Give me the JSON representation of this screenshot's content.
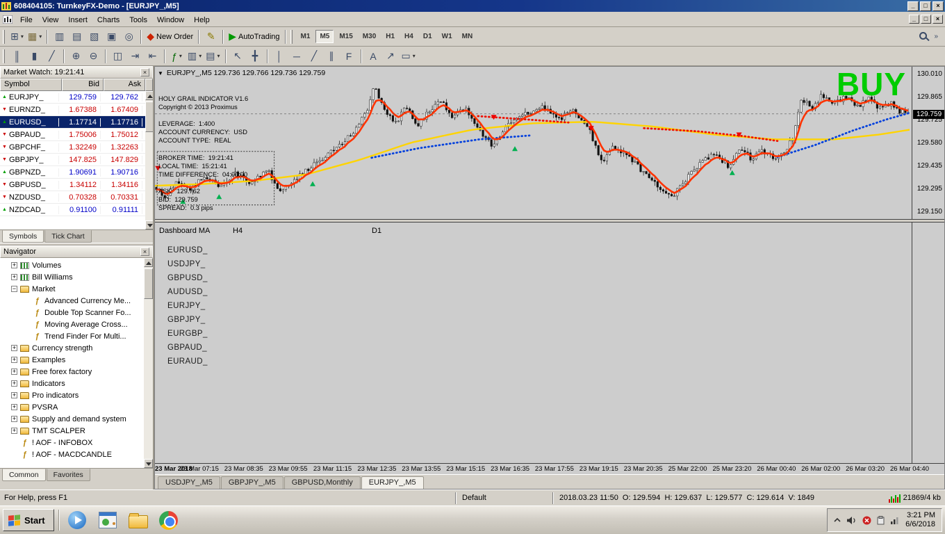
{
  "titlebar": {
    "title": "608404105: TurnkeyFX-Demo - [EURJPY_,M5]"
  },
  "window_controls": {
    "minimize": "_",
    "restore": "□",
    "close": "×"
  },
  "menubar": {
    "items": [
      "File",
      "View",
      "Insert",
      "Charts",
      "Tools",
      "Window",
      "Help"
    ]
  },
  "toolbars": {
    "row1": [
      {
        "name": "new-chart-button",
        "glyph": "⊞",
        "color": "#3a4a66",
        "drop": true
      },
      {
        "name": "profiles-button",
        "glyph": "▦",
        "color": "#7a6a3a",
        "drop": true
      },
      {
        "sep": true
      },
      {
        "name": "market-watch-toggle",
        "glyph": "▥",
        "color": "#3a4a66"
      },
      {
        "name": "data-window-toggle",
        "glyph": "▤",
        "color": "#3a4a66"
      },
      {
        "name": "navigator-toggle",
        "glyph": "▧",
        "color": "#3a4a66"
      },
      {
        "name": "terminal-toggle",
        "glyph": "▣",
        "color": "#3a4a66"
      },
      {
        "name": "strategy-tester-toggle",
        "glyph": "◎",
        "color": "#3a4a66"
      },
      {
        "sep": true
      },
      {
        "name": "new-order-button",
        "glyph": "◆",
        "color": "#cc2200",
        "label": "New Order"
      },
      {
        "sep": true
      },
      {
        "name": "metaeditor-button",
        "glyph": "✎",
        "color": "#8a7a00"
      },
      {
        "sep": true
      },
      {
        "name": "autotrading-button",
        "glyph": "▶",
        "color": "#009900",
        "label": "AutoTrading"
      },
      {
        "sep": true
      }
    ],
    "timeframes": [
      "M1",
      "M5",
      "M15",
      "M30",
      "H1",
      "H4",
      "D1",
      "W1",
      "MN"
    ],
    "active_timeframe": "M5",
    "row2": [
      {
        "name": "bar-chart-button",
        "glyph": "║",
        "color": "#3a4a66"
      },
      {
        "name": "candlestick-chart-button",
        "glyph": "▮",
        "color": "#3a4a66"
      },
      {
        "name": "line-chart-button",
        "glyph": "╱",
        "color": "#3a4a66"
      },
      {
        "sep": true
      },
      {
        "name": "zoom-in-button",
        "glyph": "⊕",
        "color": "#3a4a66"
      },
      {
        "name": "zoom-out-button",
        "glyph": "⊖",
        "color": "#3a4a66"
      },
      {
        "sep": true
      },
      {
        "name": "tile-windows-button",
        "glyph": "◫",
        "color": "#3a4a66"
      },
      {
        "name": "auto-scroll-button",
        "glyph": "⇥",
        "color": "#3a4a66"
      },
      {
        "name": "chart-shift-button",
        "glyph": "⇤",
        "color": "#3a4a66"
      },
      {
        "sep": true
      },
      {
        "name": "indicators-button",
        "glyph": "ƒ",
        "color": "#006600",
        "drop": true
      },
      {
        "name": "periods-button",
        "glyph": "▥",
        "color": "#3a4a66",
        "drop": true
      },
      {
        "name": "templates-button",
        "glyph": "▤",
        "color": "#3a4a66",
        "drop": true
      },
      {
        "sep": true
      },
      {
        "name": "cursor-button",
        "glyph": "↖",
        "color": "#3a4a66"
      },
      {
        "name": "crosshair-button",
        "glyph": "╋",
        "color": "#3a4a66"
      },
      {
        "sep": true
      },
      {
        "name": "vertical-line-button",
        "glyph": "│",
        "color": "#3a4a66"
      },
      {
        "name": "horizontal-line-button",
        "glyph": "─",
        "color": "#3a4a66"
      },
      {
        "name": "trendline-button",
        "glyph": "╱",
        "color": "#3a4a66"
      },
      {
        "name": "channel-button",
        "glyph": "∥",
        "color": "#3a4a66"
      },
      {
        "name": "fibonacci-button",
        "glyph": "F",
        "color": "#3a4a66"
      },
      {
        "sep": true
      },
      {
        "name": "text-label-button",
        "glyph": "A",
        "color": "#3a4a66"
      },
      {
        "name": "arrow-objects-button",
        "glyph": "↗",
        "color": "#3a4a66"
      },
      {
        "name": "shapes-button",
        "glyph": "▭",
        "color": "#3a4a66",
        "drop": true
      }
    ]
  },
  "market_watch": {
    "title": "Market Watch: 19:21:41",
    "columns": [
      "Symbol",
      "Bid",
      "Ask"
    ],
    "rows": [
      {
        "symbol": "EURJPY_",
        "bid": "129.759",
        "ask": "129.762",
        "dir": "up"
      },
      {
        "symbol": "EURNZD_",
        "bid": "1.67388",
        "ask": "1.67409",
        "dir": "down"
      },
      {
        "symbol": "EURUSD_",
        "bid": "1.17714",
        "ask": "1.17716",
        "dir": "up",
        "selected": true
      },
      {
        "symbol": "GBPAUD_",
        "bid": "1.75006",
        "ask": "1.75012",
        "dir": "down"
      },
      {
        "symbol": "GBPCHF_",
        "bid": "1.32249",
        "ask": "1.32263",
        "dir": "down"
      },
      {
        "symbol": "GBPJPY_",
        "bid": "147.825",
        "ask": "147.829",
        "dir": "down"
      },
      {
        "symbol": "GBPNZD_",
        "bid": "1.90691",
        "ask": "1.90716",
        "dir": "up"
      },
      {
        "symbol": "GBPUSD_",
        "bid": "1.34112",
        "ask": "1.34116",
        "dir": "down"
      },
      {
        "symbol": "NZDUSD_",
        "bid": "0.70328",
        "ask": "0.70331",
        "dir": "down"
      },
      {
        "symbol": "NZDCAD_",
        "bid": "0.91100",
        "ask": "0.91111",
        "dir": "up"
      }
    ],
    "tabs": [
      "Symbols",
      "Tick Chart"
    ],
    "active_tab": "Symbols"
  },
  "navigator": {
    "title": "Navigator",
    "items": [
      {
        "label": "Volumes",
        "depth": 1,
        "icon": "indicator-group",
        "expand": "plus"
      },
      {
        "label": "Bill Williams",
        "depth": 1,
        "icon": "indicator-group",
        "expand": "plus"
      },
      {
        "label": "Market",
        "depth": 1,
        "icon": "folder-open",
        "expand": "minus"
      },
      {
        "label": "Advanced Currency Me...",
        "depth": 2,
        "icon": "custom-indicator"
      },
      {
        "label": "Double Top Scanner Fo...",
        "depth": 2,
        "icon": "custom-indicator"
      },
      {
        "label": "Moving Average Cross...",
        "depth": 2,
        "icon": "custom-indicator"
      },
      {
        "label": "Trend Finder For Multi...",
        "depth": 2,
        "icon": "custom-indicator"
      },
      {
        "label": "Currency strength",
        "depth": 1,
        "icon": "folder",
        "expand": "plus"
      },
      {
        "label": "Examples",
        "depth": 1,
        "icon": "folder",
        "expand": "plus"
      },
      {
        "label": "Free forex factory",
        "depth": 1,
        "icon": "folder",
        "expand": "plus"
      },
      {
        "label": "Indicators",
        "depth": 1,
        "icon": "folder",
        "expand": "plus"
      },
      {
        "label": "Pro indicators",
        "depth": 1,
        "icon": "folder",
        "expand": "plus"
      },
      {
        "label": "PVSRA",
        "depth": 1,
        "icon": "folder",
        "expand": "plus"
      },
      {
        "label": "Supply and demand system",
        "depth": 1,
        "icon": "folder",
        "expand": "plus"
      },
      {
        "label": "TMT SCALPER",
        "depth": 1,
        "icon": "folder",
        "expand": "plus"
      },
      {
        "label": "! AOF - INFOBOX",
        "depth": 1,
        "icon": "custom-indicator"
      },
      {
        "label": "! AOF - MACDCANDLE",
        "depth": 1,
        "icon": "custom-indicator"
      }
    ],
    "tabs": [
      "Common",
      "Favorites"
    ],
    "active_tab": "Common"
  },
  "chart": {
    "collapse_icon": "▼",
    "ohlc_title": "EURJPY_,M5  129.736 129.766 129.736 129.759",
    "info_lines": [
      "HOLY GRAIL INDICATOR V1.6",
      "Copyright © 2013 Proximus",
      "",
      "LEVERAGE:  1:400",
      "ACCOUNT CURRENCY:  USD",
      "ACCOUNT TYPE:  REAL",
      "",
      "BROKER TIME:  19:21:41",
      "LOCAL TIME:  15:21:41",
      "TIME DIFFERENCE:  04:00:00",
      "",
      "ASK:  129.762",
      "BID:  129.759",
      "SPREAD:  0.3 pips"
    ],
    "signal": "BUY",
    "signal_color": "#00CC00",
    "price_min": 129.115,
    "price_max": 130.045,
    "price_axis": {
      "labels": [
        "130.010",
        "129.865",
        "129.725",
        "129.580",
        "129.435",
        "129.295",
        "129.150"
      ],
      "current": "129.759"
    },
    "time_labels": [
      "23 Mar 2018",
      "23 Mar 07:15",
      "23 Mar 08:35",
      "23 Mar 09:55",
      "23 Mar 11:15",
      "23 Mar 12:35",
      "23 Mar 13:55",
      "23 Mar 15:15",
      "23 Mar 16:35",
      "23 Mar 17:55",
      "23 Mar 19:15",
      "23 Mar 20:35",
      "25 Mar 22:00",
      "25 Mar 23:20",
      "26 Mar 00:40",
      "26 Mar 02:00",
      "26 Mar 03:20",
      "26 Mar 04:40"
    ],
    "candle_bull": "#efefef",
    "candle_bear": "#101010",
    "candles": {
      "count": 268,
      "anchors": [
        [
          0.0,
          129.3
        ],
        [
          0.01,
          129.22
        ],
        [
          0.025,
          129.33
        ],
        [
          0.045,
          129.29
        ],
        [
          0.065,
          129.37
        ],
        [
          0.085,
          129.3
        ],
        [
          0.105,
          129.39
        ],
        [
          0.125,
          129.33
        ],
        [
          0.148,
          129.41
        ],
        [
          0.163,
          129.28
        ],
        [
          0.185,
          129.36
        ],
        [
          0.21,
          129.44
        ],
        [
          0.235,
          129.53
        ],
        [
          0.262,
          129.64
        ],
        [
          0.28,
          129.78
        ],
        [
          0.289,
          129.94
        ],
        [
          0.296,
          129.86
        ],
        [
          0.305,
          129.76
        ],
        [
          0.32,
          129.71
        ],
        [
          0.333,
          129.81
        ],
        [
          0.347,
          129.68
        ],
        [
          0.362,
          129.77
        ],
        [
          0.378,
          129.85
        ],
        [
          0.393,
          129.73
        ],
        [
          0.412,
          129.8
        ],
        [
          0.43,
          129.65
        ],
        [
          0.447,
          129.56
        ],
        [
          0.468,
          129.7
        ],
        [
          0.492,
          129.76
        ],
        [
          0.512,
          129.81
        ],
        [
          0.533,
          129.72
        ],
        [
          0.556,
          129.78
        ],
        [
          0.576,
          129.66
        ],
        [
          0.592,
          129.46
        ],
        [
          0.608,
          129.56
        ],
        [
          0.627,
          129.5
        ],
        [
          0.652,
          129.37
        ],
        [
          0.672,
          129.29
        ],
        [
          0.687,
          129.24
        ],
        [
          0.703,
          129.34
        ],
        [
          0.722,
          129.45
        ],
        [
          0.742,
          129.51
        ],
        [
          0.762,
          129.43
        ],
        [
          0.777,
          129.55
        ],
        [
          0.792,
          129.47
        ],
        [
          0.807,
          129.53
        ],
        [
          0.822,
          129.48
        ],
        [
          0.837,
          129.53
        ],
        [
          0.848,
          129.62
        ],
        [
          0.858,
          129.86
        ],
        [
          0.872,
          129.8
        ],
        [
          0.886,
          129.88
        ],
        [
          0.902,
          129.82
        ],
        [
          0.917,
          129.87
        ],
        [
          0.932,
          129.8
        ],
        [
          0.947,
          129.85
        ],
        [
          0.962,
          129.79
        ],
        [
          0.977,
          129.83
        ],
        [
          0.99,
          129.77
        ],
        [
          1.0,
          129.77
        ]
      ]
    },
    "overlays": {
      "orange_ma": {
        "color": "#ff3300"
      },
      "yellow_ma": {
        "color": "#ffd400",
        "points": [
          [
            0,
            129.31
          ],
          [
            0.06,
            129.32
          ],
          [
            0.13,
            129.34
          ],
          [
            0.2,
            129.38
          ],
          [
            0.27,
            129.47
          ],
          [
            0.34,
            129.58
          ],
          [
            0.42,
            129.66
          ],
          [
            0.5,
            129.7
          ],
          [
            0.58,
            129.71
          ],
          [
            0.66,
            129.68
          ],
          [
            0.74,
            129.63
          ],
          [
            0.82,
            129.6
          ],
          [
            0.9,
            129.6
          ],
          [
            0.96,
            129.63
          ],
          [
            1,
            129.66
          ]
        ]
      },
      "blue_dotted": {
        "color": "#0040dd",
        "segments": [
          [
            [
              0.287,
              129.485
            ],
            [
              0.35,
              129.545
            ],
            [
              0.43,
              129.6
            ],
            [
              0.5,
              129.625
            ]
          ],
          [
            [
              0.825,
              129.49
            ],
            [
              0.875,
              129.565
            ],
            [
              0.925,
              129.655
            ],
            [
              0.97,
              129.725
            ],
            [
              1.0,
              129.765
            ]
          ]
        ]
      },
      "red_dotted": {
        "color": "#ee1100",
        "segments": [
          [
            [
              0.428,
              129.745
            ],
            [
              0.49,
              129.725
            ],
            [
              0.548,
              129.705
            ]
          ],
          [
            [
              0.648,
              129.67
            ],
            [
              0.72,
              129.65
            ],
            [
              0.78,
              129.62
            ],
            [
              0.825,
              129.59
            ]
          ]
        ]
      }
    },
    "arrows": {
      "up_color": "#00b050",
      "down_color": "#ee0000",
      "up": [
        [
          0.037,
          129.21
        ],
        [
          0.085,
          129.24
        ],
        [
          0.209,
          129.32
        ],
        [
          0.477,
          129.54
        ],
        [
          0.765,
          129.39
        ]
      ],
      "down": [
        [
          0.004,
          129.42
        ],
        [
          0.449,
          129.74
        ],
        [
          0.578,
          129.67
        ],
        [
          0.774,
          129.63
        ]
      ]
    },
    "selection_rect": [
      0.003,
      129.525,
      0.158,
      129.19
    ]
  },
  "dashboard": {
    "title": "Dashboard MA",
    "col_headers": [
      "H4",
      "D1"
    ],
    "pairs": [
      "EURUSD_",
      "USDJPY_",
      "GBPUSD_",
      "AUDUSD_",
      "EURJPY_",
      "GBPJPY_",
      "EURGBP_",
      "GBPAUD_",
      "EURAUD_"
    ]
  },
  "chart_tabs": {
    "tabs": [
      "USDJPY_,M5",
      "GBPJPY_,M5",
      "GBPUSD,Monthly",
      "EURJPY_,M5"
    ],
    "active": "EURJPY_,M5"
  },
  "status_bar": {
    "help": "For Help, press F1",
    "profile": "Default",
    "bar_info": "2018.03.23 11:50  O: 129.594  H: 129.637  L: 129.577  C: 129.614  V: 1849",
    "traffic": "21869/4 kb",
    "traffic_colors": [
      "#cc0000",
      "#00aa00",
      "#cc0000",
      "#00aa00",
      "#cc0000",
      "#00aa00"
    ]
  },
  "taskbar": {
    "start": "Start",
    "clock_time": "3:21 PM",
    "clock_date": "6/6/2018"
  }
}
